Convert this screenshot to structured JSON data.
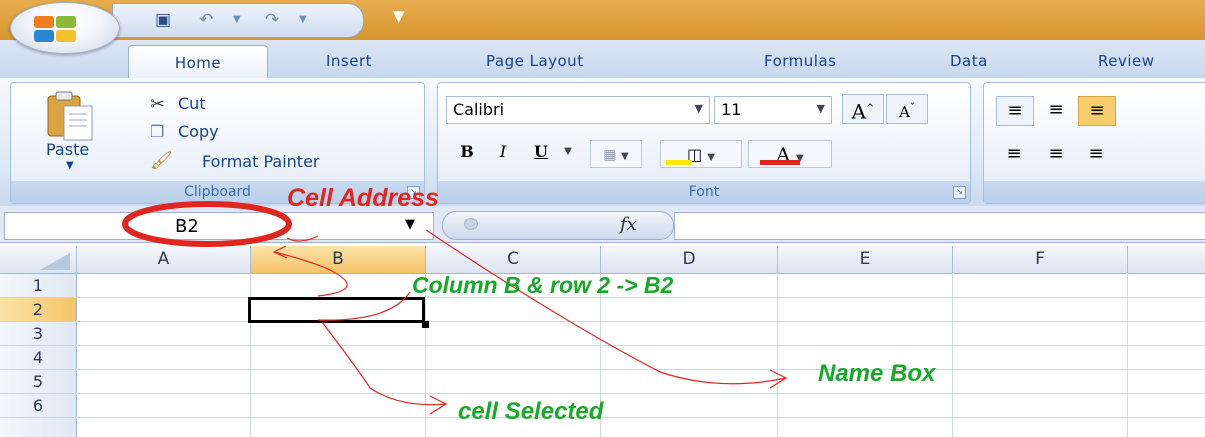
{
  "window": {
    "quick_access": {
      "save_icon": "save-icon",
      "undo_icon": "undo-icon",
      "redo_icon": "redo-icon"
    }
  },
  "tabs": [
    "Home",
    "Insert",
    "Page Layout",
    "Formulas",
    "Data",
    "Review"
  ],
  "ribbon": {
    "clipboard": {
      "paste_label": "Paste",
      "cut_label": "Cut",
      "copy_label": "Copy",
      "format_painter_label": "Format Painter",
      "group_label": "Clipboard"
    },
    "font": {
      "font_name": "Calibri",
      "font_size": "11",
      "bold": "B",
      "italic": "I",
      "underline": "U",
      "grow_font": "A",
      "shrink_font": "A",
      "font_color": "A",
      "group_label": "Font"
    }
  },
  "formula_bar": {
    "name_box_value": "B2",
    "fx_label": "fx",
    "formula_value": ""
  },
  "grid": {
    "columns": [
      "A",
      "B",
      "C",
      "D",
      "E",
      "F"
    ],
    "rows": [
      "1",
      "2",
      "3",
      "4",
      "5",
      "6"
    ],
    "selected_column": "B",
    "selected_row": "2"
  },
  "annotations": {
    "cell_address": "Cell Address",
    "column_row": "Column B & row 2 -> B2",
    "name_box": "Name Box",
    "cell_selected": "cell Selected",
    "colors": {
      "red": "#e0261f",
      "green": "#18a82a"
    }
  },
  "colors": {
    "tab_text": "#15428b",
    "title_bar": "#d9952f",
    "selection_header": "#f5c36a"
  }
}
